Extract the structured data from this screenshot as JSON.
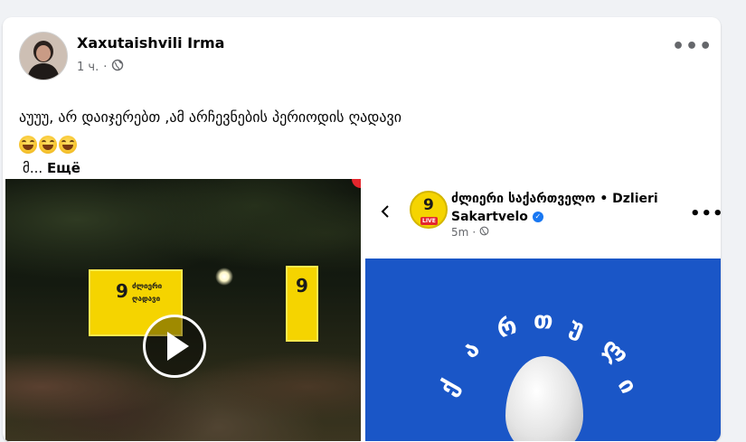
{
  "post": {
    "author": "Xaxutaishvili Irma",
    "time": "1 ч.",
    "separator": "·",
    "text": "აუუუ, არ დაიჯერებთ ,ამ არჩევნების პერიოდის ღადავი",
    "see_more_prefix": "მ...",
    "see_more_label": "Ещё",
    "more_options": "•••"
  },
  "video": {
    "banner_number": "9",
    "banner_line1": "ძლიერი",
    "banner_line2": "ღადავი"
  },
  "shared_post": {
    "page_name": "ძლიერი საქართველო • Dzlieri Sakartvelo",
    "time": "5m",
    "separator": "·",
    "logo_number": "9",
    "logo_live": "LIVE",
    "more_options": "•••",
    "image_letters": [
      "ქ",
      "ა",
      "რ",
      "თ",
      "უ",
      "ლ",
      "ი"
    ]
  },
  "colors": {
    "background": "#f0f2f5",
    "card": "#ffffff",
    "secondary_text": "#65676b",
    "verified": "#1877f2",
    "blue_panel": "#1a56c7",
    "brand_yellow": "#f5d400"
  }
}
